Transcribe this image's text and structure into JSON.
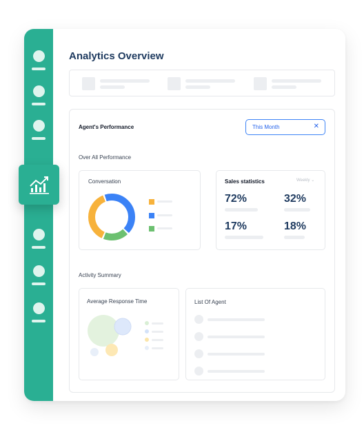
{
  "title": "Analytics Overview",
  "agents_performance": {
    "heading": "Agent's Performance",
    "filter_value": "This Month",
    "clear_icon": "close-icon"
  },
  "overall_performance": {
    "heading": "Over All Performance",
    "conversation": {
      "heading": "Conversation",
      "segments": [
        {
          "color": "#f7b23b",
          "value": 0.38
        },
        {
          "color": "#3b82f6",
          "value": 0.43
        },
        {
          "color": "#6cc070",
          "value": 0.19
        }
      ],
      "legend_colors": [
        "#f7b23b",
        "#3b82f6",
        "#6cc070"
      ]
    },
    "sales_statistics": {
      "heading": "Sales statistics",
      "period": "Weekly",
      "values": [
        "72%",
        "32%",
        "17%",
        "18%"
      ]
    }
  },
  "activity_summary": {
    "heading": "Activity Summary",
    "response_time": {
      "heading": "Average Response Time",
      "legend_colors": [
        "#d9efd5",
        "#d3e2f9",
        "#fbe5a9",
        "#e6eef9"
      ]
    },
    "agent_list": {
      "heading": "List Of Agent"
    }
  },
  "sidebar": {
    "accent": "#2aaf93",
    "active_icon": "chart-icon"
  }
}
